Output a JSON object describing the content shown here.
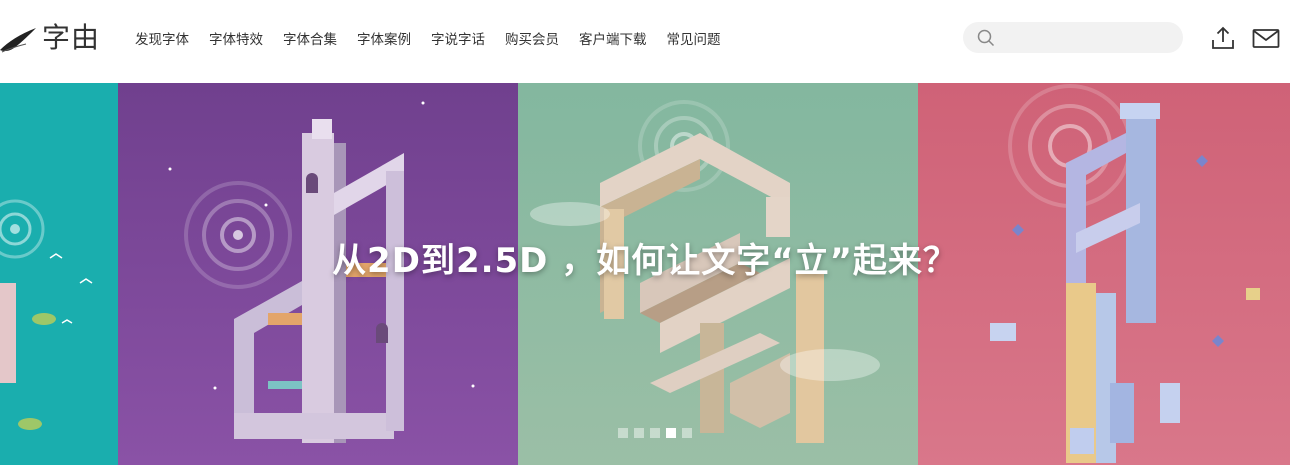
{
  "logo": {
    "text": "字由",
    "icon": "brush-stroke-icon"
  },
  "nav": {
    "items": [
      {
        "label": "发现字体"
      },
      {
        "label": "字体特效"
      },
      {
        "label": "字体合集"
      },
      {
        "label": "字体案例"
      },
      {
        "label": "字说字话"
      },
      {
        "label": "购买会员"
      },
      {
        "label": "客户端下载"
      },
      {
        "label": "常见问题"
      }
    ]
  },
  "search": {
    "placeholder": "",
    "value": "",
    "icon": "search-icon"
  },
  "header_icons": {
    "upload": "upload-icon",
    "mail": "mail-icon"
  },
  "banner": {
    "headline": "从2D到2.5D ，如何让文字“立”起来？",
    "panel_colors": [
      "#1aaeae",
      "#7a4798",
      "#8cba a2",
      "#d46d80"
    ],
    "dots": {
      "count": 5,
      "active_index": 3
    }
  }
}
